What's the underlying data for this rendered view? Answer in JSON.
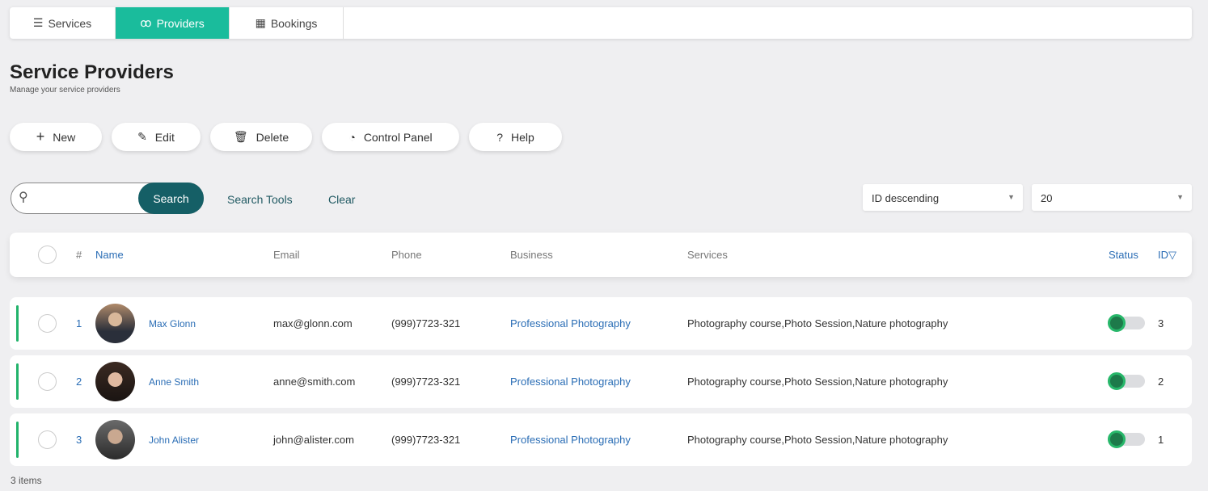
{
  "tabs": [
    {
      "label": "Services",
      "icon": "list-icon"
    },
    {
      "label": "Providers",
      "icon": "users-icon",
      "active": true
    },
    {
      "label": "Bookings",
      "icon": "calendar-icon"
    }
  ],
  "page": {
    "title": "Service Providers",
    "subtitle": "Manage your service providers"
  },
  "toolbar": {
    "new": "New",
    "edit": "Edit",
    "delete": "Delete",
    "control_panel": "Control Panel",
    "help": "Help"
  },
  "search": {
    "placeholder": "",
    "button": "Search",
    "tools": "Search Tools",
    "clear": "Clear"
  },
  "sort": {
    "selected": "ID descending"
  },
  "page_size": {
    "selected": "20"
  },
  "columns": {
    "num": "#",
    "name": "Name",
    "email": "Email",
    "phone": "Phone",
    "business": "Business",
    "services": "Services",
    "status": "Status",
    "id": "ID"
  },
  "rows": [
    {
      "num": "1",
      "name": "Max Glonn",
      "email": "max@glonn.com",
      "phone": "(999)7723-321",
      "business": "Professional Photography",
      "services": "Photography course,Photo Session,Nature photography",
      "status": true,
      "id": "3"
    },
    {
      "num": "2",
      "name": "Anne Smith",
      "email": "anne@smith.com",
      "phone": "(999)7723-321",
      "business": "Professional Photography",
      "services": "Photography course,Photo Session,Nature photography",
      "status": true,
      "id": "2"
    },
    {
      "num": "3",
      "name": "John Alister",
      "email": "john@alister.com",
      "phone": "(999)7723-321",
      "business": "Professional Photography",
      "services": "Photography course,Photo Session,Nature photography",
      "status": true,
      "id": "1"
    }
  ],
  "footer": {
    "count": "3 items"
  },
  "colors": {
    "accent": "#1abc9c",
    "search_button": "#155f66",
    "active_bar": "#22b36b",
    "link": "#2a6db5"
  }
}
